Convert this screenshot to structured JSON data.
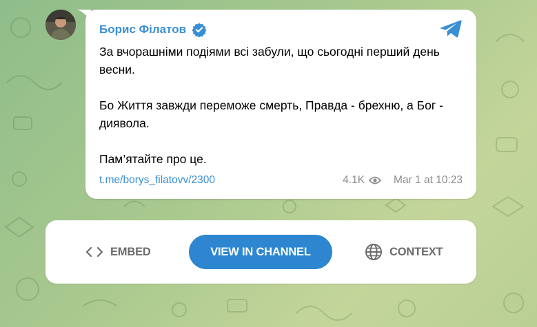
{
  "colors": {
    "accent": "#2d86cf",
    "link": "#3a8fd4",
    "meta_gray": "#8d8d8d",
    "background": "#a9c98e"
  },
  "post": {
    "author_name": "Борис Філатов",
    "verified_icon": "verified-badge-icon",
    "paragraphs": [
      "За вчорашніми подіями всі забули, що сьогодні перший день весни.",
      "Бо Життя завжди переможе смерть, Правда - брехню, а Бог - диявола.",
      "Пам’ятайте про це."
    ],
    "link_text": "t.me/borys_filatovv/2300",
    "views": "4.1K",
    "date": "Mar 1 at 10:23"
  },
  "actions": {
    "embed_label": "EMBED",
    "view_label": "VIEW IN CHANNEL",
    "context_label": "CONTEXT"
  }
}
